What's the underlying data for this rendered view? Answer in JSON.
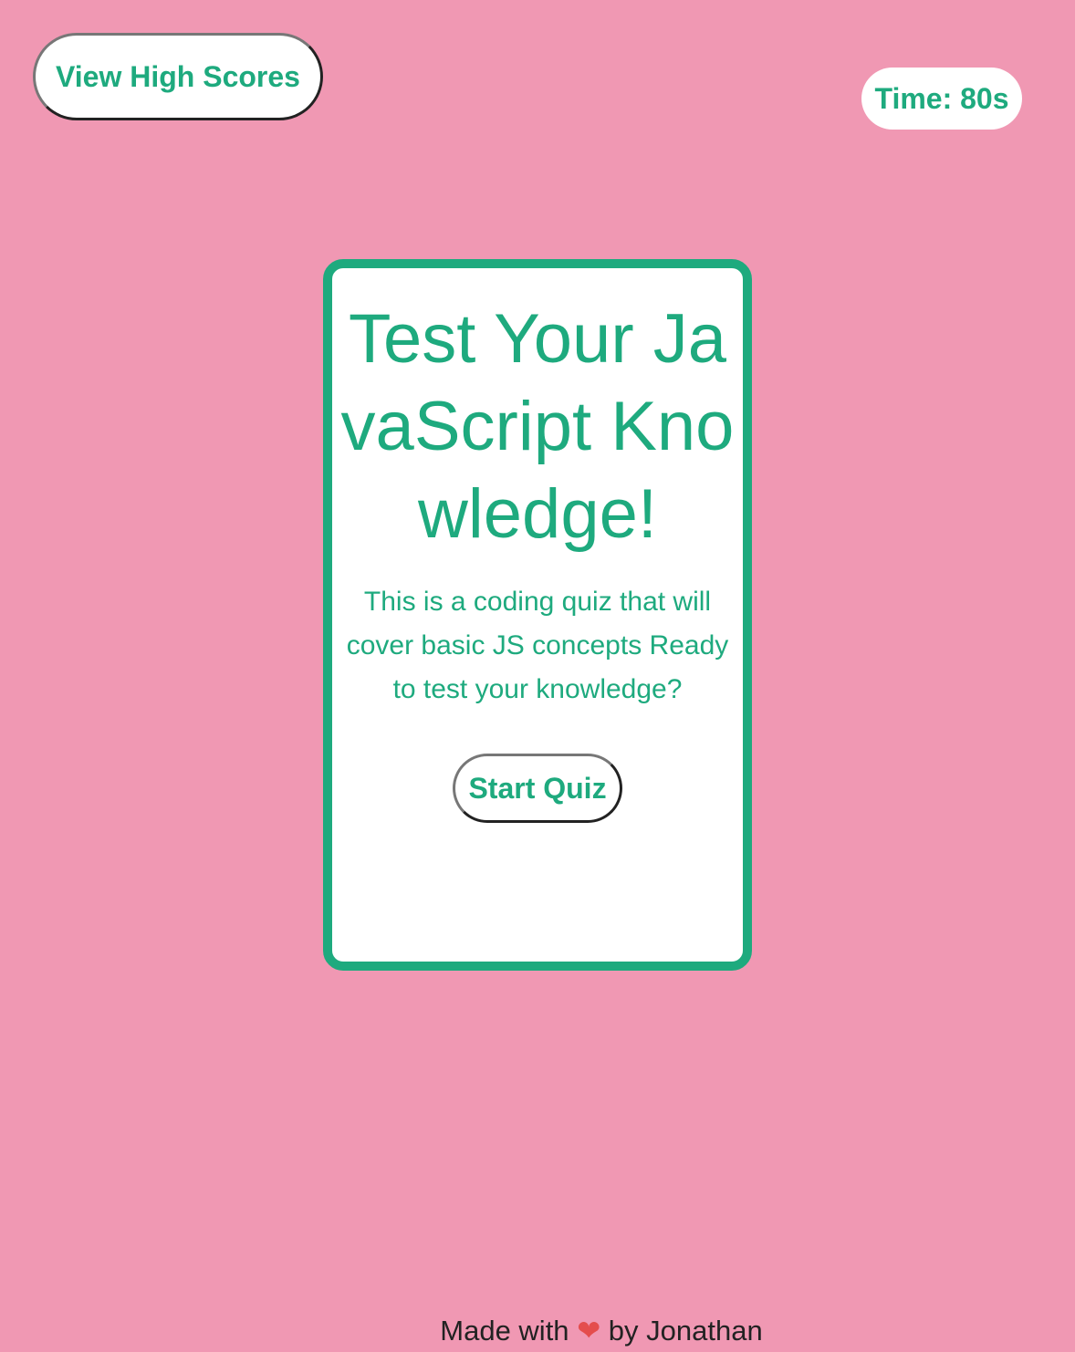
{
  "header": {
    "high_scores_label": "View High Scores",
    "timer_text": "Time: 80s"
  },
  "card": {
    "title": "Test Your JavaScript Knowledge!",
    "description": "This is a coding quiz that will cover basic JS concepts Ready to test your knowledge?",
    "start_label": "Start Quiz"
  },
  "footer": {
    "prefix": "Made with",
    "heart_icon": "heart-icon",
    "suffix": "by Jonathan"
  },
  "colors": {
    "background": "#f098b3",
    "accent": "#1eaa7e",
    "heart": "#e44d4d"
  }
}
